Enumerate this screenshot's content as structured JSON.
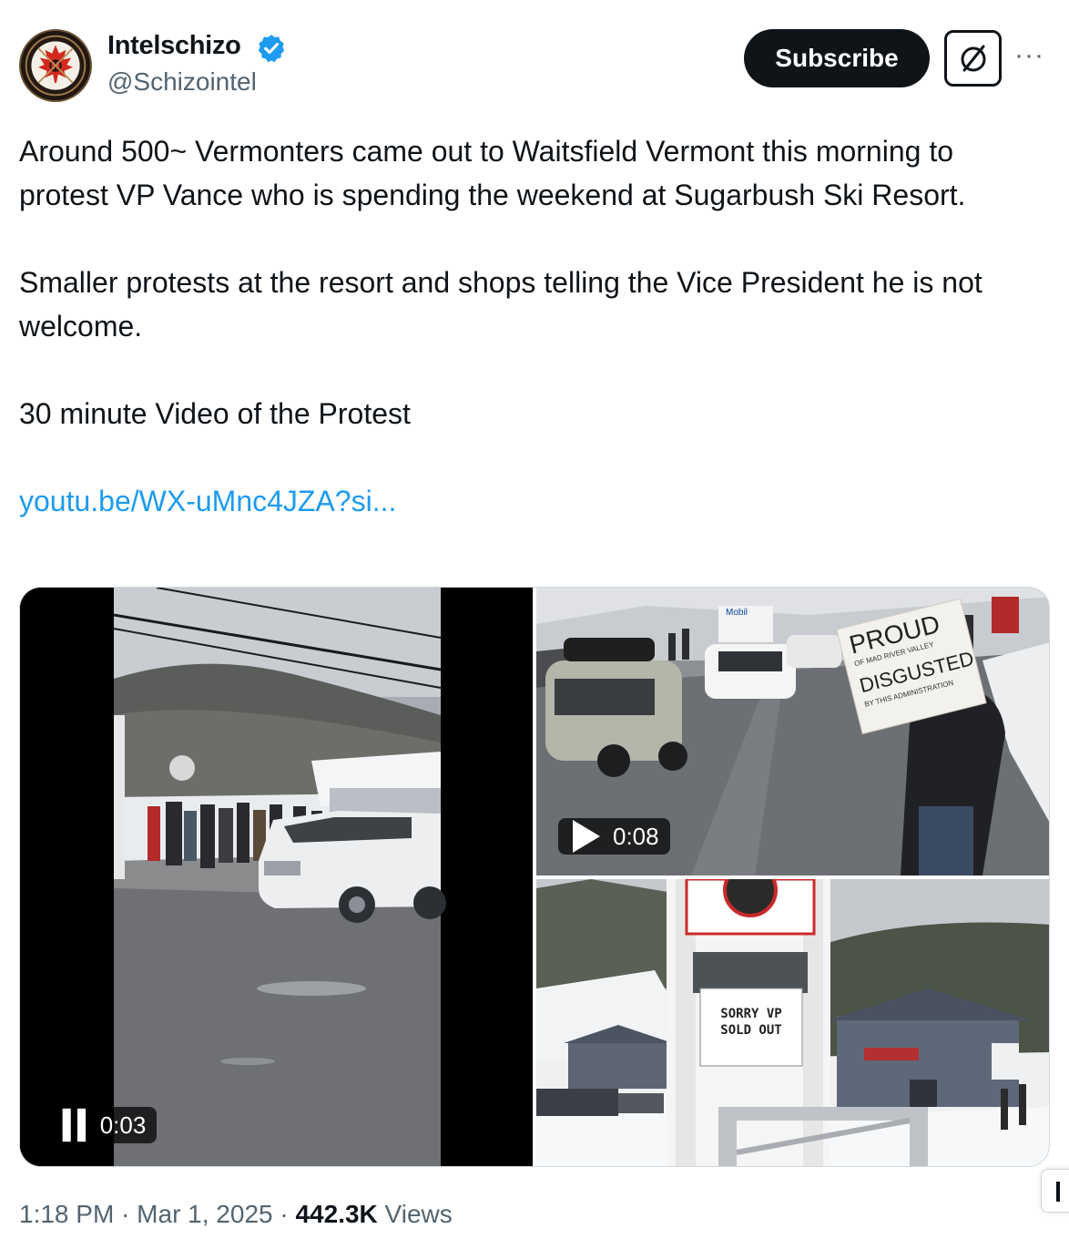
{
  "author": {
    "name": "Intelschizo",
    "handle": "@Schizointel",
    "verified": true
  },
  "actions": {
    "subscribe_label": "Subscribe",
    "grok_icon": "grok-icon",
    "more_label": "···"
  },
  "tweet": {
    "paragraph1": "Around 500~ Vermonters came out to Waitsfield Vermont this morning to protest VP Vance who is spending the weekend at Sugarbush Ski Resort.",
    "paragraph2": "Smaller protests at the resort and shops telling the Vice President he is not welcome.",
    "paragraph3": "30 minute Video of the Protest",
    "link": "youtu.be/WX-uMnc4JZA?si..."
  },
  "media": {
    "video1": {
      "time": "0:03",
      "state": "pause"
    },
    "video2": {
      "time": "0:08",
      "state": "play"
    },
    "protest_sign": {
      "line1": "PROUD",
      "line2": "OF MAD RIVER VALLEY",
      "line3": "DISGUSTED",
      "line4": "BY THIS ADMINISTRATION"
    },
    "resort_sign": {
      "line1": "SORRY VP",
      "line2": "SOLD OUT"
    },
    "store_sign": "Mobil"
  },
  "meta": {
    "time": "1:18 PM",
    "sep1": " · ",
    "date": "Mar 1, 2025",
    "sep2": " · ",
    "views_count": "442.3K",
    "views_label": " Views"
  },
  "colors": {
    "link": "#1d9bf0",
    "verified": "#1d9bf0",
    "text": "#0f1419",
    "secondary": "#536471"
  }
}
